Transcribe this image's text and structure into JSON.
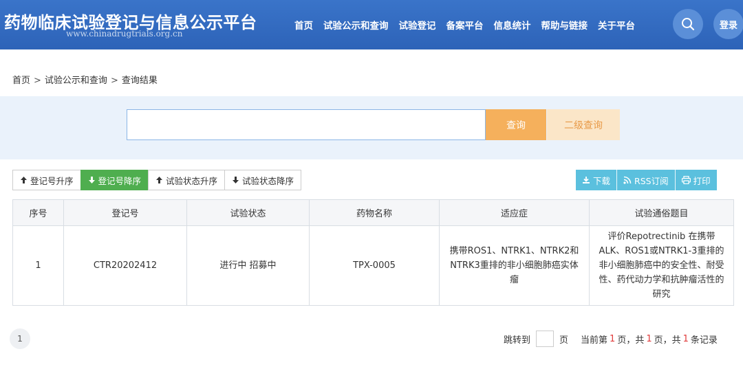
{
  "header": {
    "title": "药物临床试验登记与信息公示平台",
    "url": "www.chinadrugtrials.org.cn",
    "nav": [
      "首页",
      "试验公示和查询",
      "试验登记",
      "备案平台",
      "信息统计",
      "帮助与链接",
      "关于平台"
    ],
    "search_icon": "search-icon",
    "login_label": "登录"
  },
  "breadcrumb": {
    "items": [
      "首页",
      "试验公示和查询",
      "查询结果"
    ],
    "separator": ">"
  },
  "search": {
    "value": "",
    "placeholder": "",
    "query_label": "查询",
    "secondary_label": "二级查询"
  },
  "sort_buttons": [
    {
      "label": "登记号升序",
      "icon": "arrow-up-icon",
      "active": false
    },
    {
      "label": "登记号降序",
      "icon": "arrow-down-icon",
      "active": true
    },
    {
      "label": "试验状态升序",
      "icon": "arrow-up-icon",
      "active": false
    },
    {
      "label": "试验状态降序",
      "icon": "arrow-down-icon",
      "active": false
    }
  ],
  "tools": {
    "download": "下载",
    "rss": "RSS订阅",
    "print": "打印"
  },
  "table": {
    "headers": [
      "序号",
      "登记号",
      "试验状态",
      "药物名称",
      "适应症",
      "试验通俗题目"
    ],
    "rows": [
      [
        "1",
        "CTR20202412",
        "进行中 招募中",
        "TPX-0005",
        "携带ROS1、NTRK1、NTRK2和NTRK3重排的非小细胞肺癌实体瘤",
        "评价Repotrectinib 在携带ALK、ROS1或NTRK1-3重排的非小细胞肺癌中的安全性、耐受性、药代动力学和抗肿瘤活性的研究"
      ]
    ]
  },
  "pagination": {
    "current_page_button": "1",
    "jump_label": "跳转到",
    "page_unit": "页",
    "current_prefix": "当前第",
    "current_page": "1",
    "page_suffix": "页，共",
    "total_pages": "1",
    "records_prefix": "页，共",
    "total_records": "1",
    "records_suffix": "条记录"
  },
  "colors": {
    "header_bg": "#2d63b8",
    "query_btn": "#f5b05c",
    "active_sort": "#4fae4f",
    "tool_btn": "#5bc0de",
    "highlight_number": "#e03a3a"
  }
}
